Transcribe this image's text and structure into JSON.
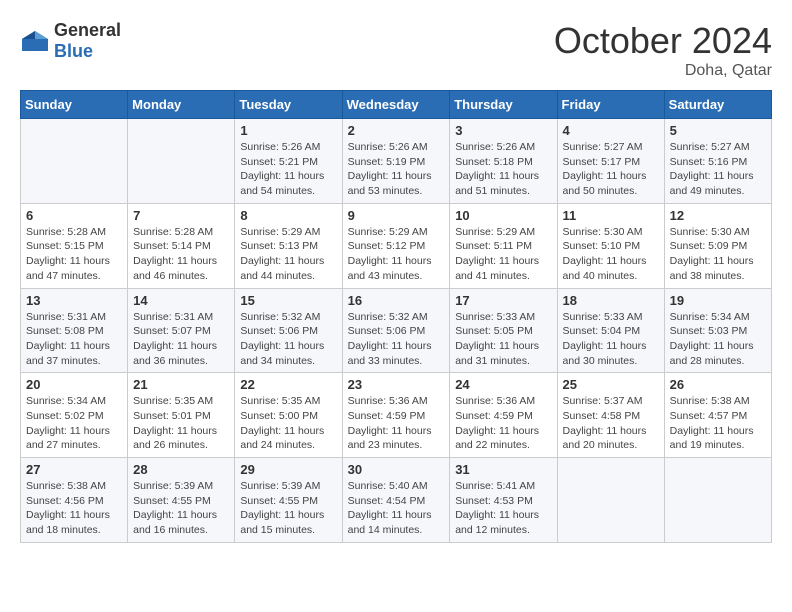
{
  "header": {
    "logo": {
      "general": "General",
      "blue": "Blue"
    },
    "title": "October 2024",
    "location": "Doha, Qatar"
  },
  "days_of_week": [
    "Sunday",
    "Monday",
    "Tuesday",
    "Wednesday",
    "Thursday",
    "Friday",
    "Saturday"
  ],
  "weeks": [
    [
      {
        "day": "",
        "info": ""
      },
      {
        "day": "",
        "info": ""
      },
      {
        "day": "1",
        "info": "Sunrise: 5:26 AM\nSunset: 5:21 PM\nDaylight: 11 hours and 54 minutes."
      },
      {
        "day": "2",
        "info": "Sunrise: 5:26 AM\nSunset: 5:19 PM\nDaylight: 11 hours and 53 minutes."
      },
      {
        "day": "3",
        "info": "Sunrise: 5:26 AM\nSunset: 5:18 PM\nDaylight: 11 hours and 51 minutes."
      },
      {
        "day": "4",
        "info": "Sunrise: 5:27 AM\nSunset: 5:17 PM\nDaylight: 11 hours and 50 minutes."
      },
      {
        "day": "5",
        "info": "Sunrise: 5:27 AM\nSunset: 5:16 PM\nDaylight: 11 hours and 49 minutes."
      }
    ],
    [
      {
        "day": "6",
        "info": "Sunrise: 5:28 AM\nSunset: 5:15 PM\nDaylight: 11 hours and 47 minutes."
      },
      {
        "day": "7",
        "info": "Sunrise: 5:28 AM\nSunset: 5:14 PM\nDaylight: 11 hours and 46 minutes."
      },
      {
        "day": "8",
        "info": "Sunrise: 5:29 AM\nSunset: 5:13 PM\nDaylight: 11 hours and 44 minutes."
      },
      {
        "day": "9",
        "info": "Sunrise: 5:29 AM\nSunset: 5:12 PM\nDaylight: 11 hours and 43 minutes."
      },
      {
        "day": "10",
        "info": "Sunrise: 5:29 AM\nSunset: 5:11 PM\nDaylight: 11 hours and 41 minutes."
      },
      {
        "day": "11",
        "info": "Sunrise: 5:30 AM\nSunset: 5:10 PM\nDaylight: 11 hours and 40 minutes."
      },
      {
        "day": "12",
        "info": "Sunrise: 5:30 AM\nSunset: 5:09 PM\nDaylight: 11 hours and 38 minutes."
      }
    ],
    [
      {
        "day": "13",
        "info": "Sunrise: 5:31 AM\nSunset: 5:08 PM\nDaylight: 11 hours and 37 minutes."
      },
      {
        "day": "14",
        "info": "Sunrise: 5:31 AM\nSunset: 5:07 PM\nDaylight: 11 hours and 36 minutes."
      },
      {
        "day": "15",
        "info": "Sunrise: 5:32 AM\nSunset: 5:06 PM\nDaylight: 11 hours and 34 minutes."
      },
      {
        "day": "16",
        "info": "Sunrise: 5:32 AM\nSunset: 5:06 PM\nDaylight: 11 hours and 33 minutes."
      },
      {
        "day": "17",
        "info": "Sunrise: 5:33 AM\nSunset: 5:05 PM\nDaylight: 11 hours and 31 minutes."
      },
      {
        "day": "18",
        "info": "Sunrise: 5:33 AM\nSunset: 5:04 PM\nDaylight: 11 hours and 30 minutes."
      },
      {
        "day": "19",
        "info": "Sunrise: 5:34 AM\nSunset: 5:03 PM\nDaylight: 11 hours and 28 minutes."
      }
    ],
    [
      {
        "day": "20",
        "info": "Sunrise: 5:34 AM\nSunset: 5:02 PM\nDaylight: 11 hours and 27 minutes."
      },
      {
        "day": "21",
        "info": "Sunrise: 5:35 AM\nSunset: 5:01 PM\nDaylight: 11 hours and 26 minutes."
      },
      {
        "day": "22",
        "info": "Sunrise: 5:35 AM\nSunset: 5:00 PM\nDaylight: 11 hours and 24 minutes."
      },
      {
        "day": "23",
        "info": "Sunrise: 5:36 AM\nSunset: 4:59 PM\nDaylight: 11 hours and 23 minutes."
      },
      {
        "day": "24",
        "info": "Sunrise: 5:36 AM\nSunset: 4:59 PM\nDaylight: 11 hours and 22 minutes."
      },
      {
        "day": "25",
        "info": "Sunrise: 5:37 AM\nSunset: 4:58 PM\nDaylight: 11 hours and 20 minutes."
      },
      {
        "day": "26",
        "info": "Sunrise: 5:38 AM\nSunset: 4:57 PM\nDaylight: 11 hours and 19 minutes."
      }
    ],
    [
      {
        "day": "27",
        "info": "Sunrise: 5:38 AM\nSunset: 4:56 PM\nDaylight: 11 hours and 18 minutes."
      },
      {
        "day": "28",
        "info": "Sunrise: 5:39 AM\nSunset: 4:55 PM\nDaylight: 11 hours and 16 minutes."
      },
      {
        "day": "29",
        "info": "Sunrise: 5:39 AM\nSunset: 4:55 PM\nDaylight: 11 hours and 15 minutes."
      },
      {
        "day": "30",
        "info": "Sunrise: 5:40 AM\nSunset: 4:54 PM\nDaylight: 11 hours and 14 minutes."
      },
      {
        "day": "31",
        "info": "Sunrise: 5:41 AM\nSunset: 4:53 PM\nDaylight: 11 hours and 12 minutes."
      },
      {
        "day": "",
        "info": ""
      },
      {
        "day": "",
        "info": ""
      }
    ]
  ]
}
